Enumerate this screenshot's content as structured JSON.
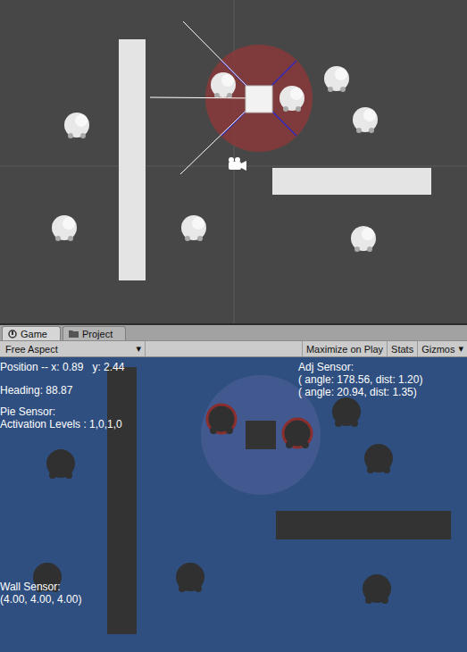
{
  "tabs": [
    {
      "label": "Game",
      "selected": true
    },
    {
      "label": "Project",
      "selected": false
    }
  ],
  "toolbar": {
    "aspect": "Free Aspect",
    "dropdown_arrow": "▾",
    "buttons": [
      {
        "label": "Maximize on Play",
        "on": false,
        "dropdown": false
      },
      {
        "label": "Stats",
        "on": false,
        "dropdown": false
      },
      {
        "label": "Gizmos",
        "on": false,
        "dropdown": true
      }
    ]
  },
  "hud": {
    "position": "Position -- x: 0.89   y: 2.44",
    "heading": "Heading: 88.87",
    "pie_sensor": {
      "title": "Pie Sensor:",
      "levels": "Activation Levels : 1,0,1,0"
    },
    "wall_sensor": {
      "title": "Wall Sensor:",
      "reading": "(4.00, 4.00, 4.00)"
    },
    "adj_sensor": {
      "title": "Adj Sensor:",
      "readings": [
        "( angle: 178.56, dist: 1.20)",
        "( angle: 20.94, dist: 1.35)"
      ]
    }
  }
}
